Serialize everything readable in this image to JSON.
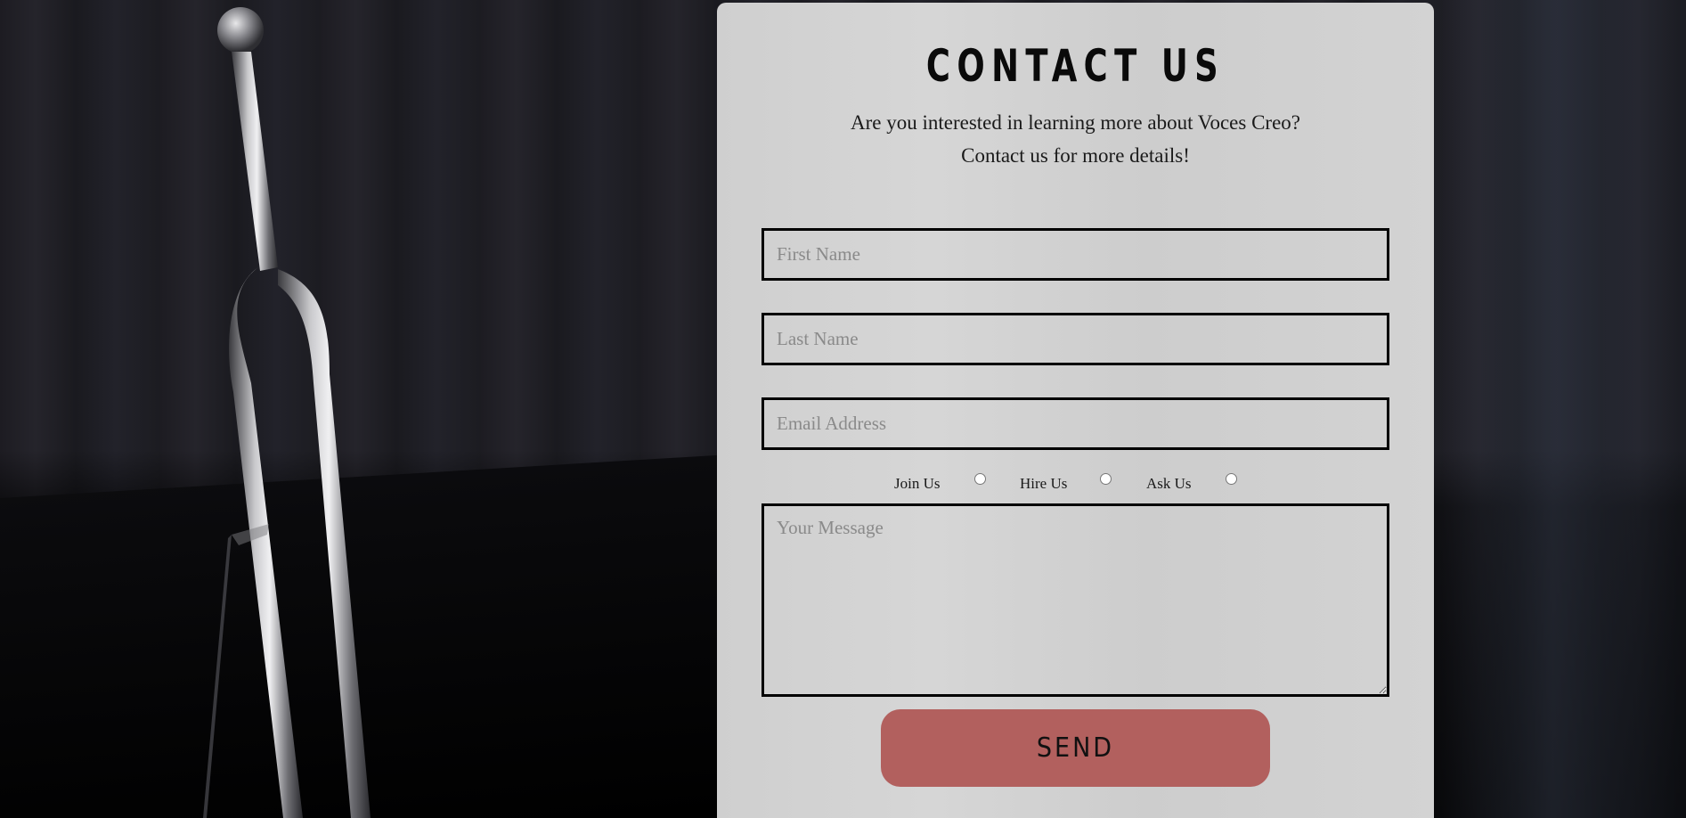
{
  "contact": {
    "title": "CONTACT US",
    "subtitle_line1": "Are you interested in learning more about Voces Creo?",
    "subtitle_line2": "Contact us for more details!"
  },
  "form": {
    "first_name_placeholder": "First Name",
    "last_name_placeholder": "Last Name",
    "email_placeholder": "Email Address",
    "radio_options": [
      "Join Us",
      "Hire Us",
      "Ask Us"
    ],
    "message_placeholder": "Your Message",
    "send_label": "SEND"
  },
  "colors": {
    "card_background": "#d2d2d2",
    "send_button": "#b2605e",
    "field_border": "#000000"
  }
}
